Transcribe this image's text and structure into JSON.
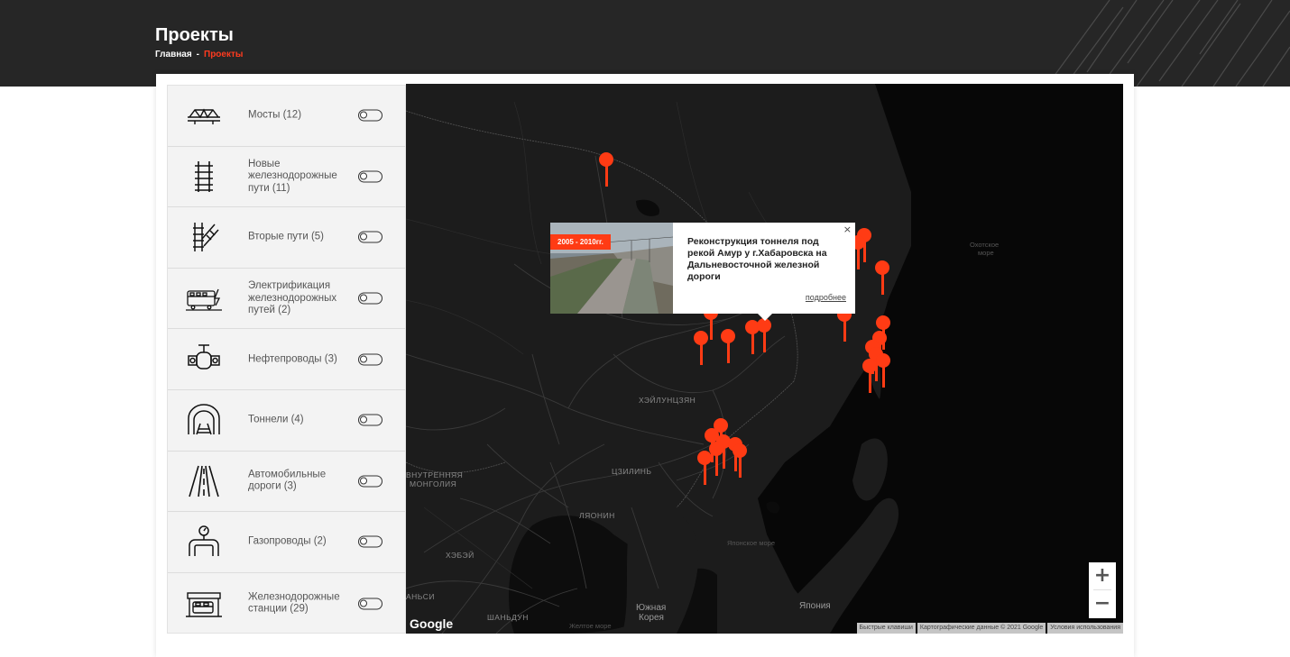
{
  "header": {
    "title": "Проекты",
    "breadcrumb": {
      "home": "Главная",
      "separator": "-",
      "current": "Проекты"
    }
  },
  "sidebar": {
    "items": [
      {
        "label": "Мосты (12)",
        "icon": "bridge-icon"
      },
      {
        "label": "Новые железнодорожные пути (11)",
        "icon": "railway-track-icon"
      },
      {
        "label": "Вторые пути (5)",
        "icon": "second-track-icon"
      },
      {
        "label": "Электрификация железнодорожных путей (2)",
        "icon": "electrified-train-icon"
      },
      {
        "label": "Нефтепроводы (3)",
        "icon": "oil-pipeline-valve-icon"
      },
      {
        "label": "Тоннели (4)",
        "icon": "tunnel-icon"
      },
      {
        "label": "Автомобильные дороги (3)",
        "icon": "road-icon"
      },
      {
        "label": "Газопроводы (2)",
        "icon": "gas-pipeline-icon"
      },
      {
        "label": "Железнодорожные станции (29)",
        "icon": "railway-station-icon"
      }
    ]
  },
  "map": {
    "labels": {
      "heilongjiang": "ХЭЙЛУНЦЗЯН",
      "jilin": "ЦЗИЛИНЬ",
      "liaoning": "ЛЯОНИН",
      "hebei": "ХЭБЭЙ",
      "shandong": "ШАНЬДУН",
      "inner_mongolia_1": "ВНУТРЕННЯЯ",
      "inner_mongolia_2": "МОНГОЛИЯ",
      "beijing_partial": "АНЬСИ",
      "okhotsk_1": "Охотское",
      "okhotsk_2": "море",
      "sea_of_japan": "Японское море",
      "yellow_sea": "Желтое море",
      "south_korea_1": "Южная",
      "south_korea_2": "Корея",
      "japan": "Япония"
    },
    "popup": {
      "badge": "2005 - 2010гг.",
      "title": "Реконструкция тоннеля под рекой Амур у г.Хабаровска на Дальневосточной железной дороги",
      "more_link": "подробнее",
      "close": "×"
    },
    "zoom": {
      "in": "+",
      "out": "−"
    },
    "google": "Google",
    "attribution": {
      "shortcuts": "Быстрые клавиши",
      "map_data": "Картографические данные © 2021 Google",
      "terms": "Условия использования"
    },
    "accent_color": "#ff3b14"
  }
}
